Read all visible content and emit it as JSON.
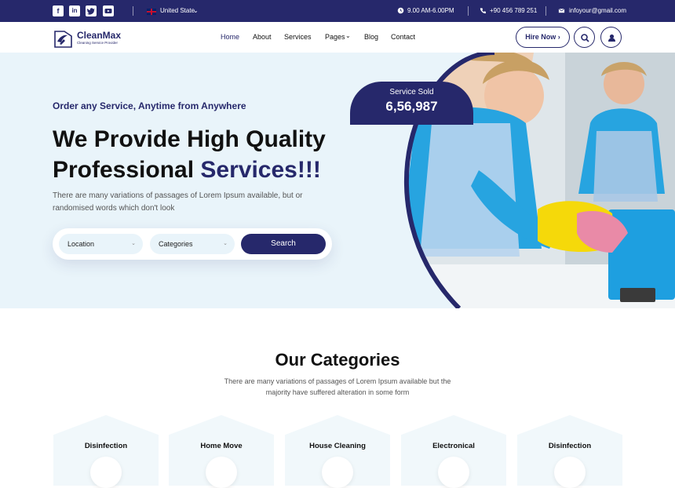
{
  "topbar": {
    "socials": [
      "facebook-icon",
      "linkedin-icon",
      "twitter-icon",
      "youtube-icon"
    ],
    "region": "United State",
    "hours": "9.00 AM-6.00PM",
    "phone": "+90 456 789 251",
    "email": "infoyour@gmail.com"
  },
  "brand": {
    "name": "CleanMax",
    "tagline": "Cleaning Service Provider"
  },
  "nav": {
    "items": [
      {
        "label": "Home",
        "active": true
      },
      {
        "label": "Services",
        "active": false
      },
      {
        "label": "Services",
        "active": false
      },
      {
        "label": "Pages",
        "active": false
      },
      {
        "label": "Blog",
        "active": false
      },
      {
        "label": "Contact",
        "active": false
      }
    ],
    "about_label": "About",
    "hire_label": "Hire Now"
  },
  "hero": {
    "tagline": "Order any Service, Anytime from Anywhere",
    "title_plain": "We Provide High Quality Professional",
    "title_highlight": "Services!!!",
    "description": "There are many variations of passages of Lorem Ipsum available, but or randomised words which don't look",
    "location_label": "Location",
    "categories_label": "Categories",
    "search_label": "Search",
    "sold_label": "Service Sold",
    "sold_value": "6,56,987"
  },
  "categories": {
    "title": "Our Categories",
    "description": "There are many variations of passages of Lorem Ipsum available but the majority have suffered alteration in some form",
    "items": [
      "Disinfection",
      "Home Move",
      "House Cleaning",
      "Electronical",
      "Disinfection"
    ]
  },
  "colors": {
    "primary": "#26286b",
    "hero_bg": "#e9f4fa",
    "accent_blue": "#1e9fe0"
  }
}
